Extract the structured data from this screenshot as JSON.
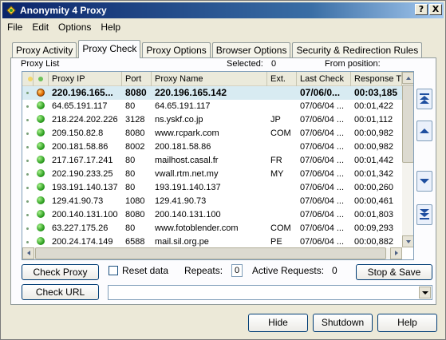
{
  "window": {
    "title": "Anonymity 4 Proxy",
    "help_btn": "?",
    "close_btn": "X"
  },
  "menu": [
    "File",
    "Edit",
    "Options",
    "Help"
  ],
  "tabs": [
    {
      "label": "Proxy Activity"
    },
    {
      "label": "Proxy Check",
      "active": true
    },
    {
      "label": "Proxy Options"
    },
    {
      "label": "Browser Options"
    },
    {
      "label": "Security & Redirection Rules"
    }
  ],
  "panel": {
    "list_label": "Proxy List",
    "selected_label": "Selected:",
    "selected_value": "0",
    "from_position_label": "From position:"
  },
  "table": {
    "columns": [
      "",
      "",
      "Proxy IP",
      "Port",
      "Proxy Name",
      "Ext.",
      "Last Check",
      "Response Time"
    ],
    "rows": [
      {
        "ip": "220.196.165...",
        "port": "8080",
        "name": "220.196.165.142",
        "ext": "",
        "last_check": "07/06/0...",
        "response": "00:03,185",
        "status": "busy",
        "selected": true
      },
      {
        "ip": "64.65.191.117",
        "port": "80",
        "name": "64.65.191.117",
        "ext": "",
        "last_check": "07/06/04 ...",
        "response": "00:01,422",
        "status": "ok"
      },
      {
        "ip": "218.224.202.226",
        "port": "3128",
        "name": "ns.yskf.co.jp",
        "ext": "JP",
        "last_check": "07/06/04 ...",
        "response": "00:01,112",
        "status": "ok"
      },
      {
        "ip": "209.150.82.8",
        "port": "8080",
        "name": "www.rcpark.com",
        "ext": "COM",
        "last_check": "07/06/04 ...",
        "response": "00:00,982",
        "status": "ok"
      },
      {
        "ip": "200.181.58.86",
        "port": "8002",
        "name": "200.181.58.86",
        "ext": "",
        "last_check": "07/06/04 ...",
        "response": "00:00,982",
        "status": "ok"
      },
      {
        "ip": "217.167.17.241",
        "port": "80",
        "name": "mailhost.casal.fr",
        "ext": "FR",
        "last_check": "07/06/04 ...",
        "response": "00:01,442",
        "status": "ok"
      },
      {
        "ip": "202.190.233.25",
        "port": "80",
        "name": "vwall.rtm.net.my",
        "ext": "MY",
        "last_check": "07/06/04 ...",
        "response": "00:01,342",
        "status": "ok"
      },
      {
        "ip": "193.191.140.137",
        "port": "80",
        "name": "193.191.140.137",
        "ext": "",
        "last_check": "07/06/04 ...",
        "response": "00:00,260",
        "status": "ok"
      },
      {
        "ip": "129.41.90.73",
        "port": "1080",
        "name": "129.41.90.73",
        "ext": "",
        "last_check": "07/06/04 ...",
        "response": "00:00,461",
        "status": "ok"
      },
      {
        "ip": "200.140.131.100",
        "port": "8080",
        "name": "200.140.131.100",
        "ext": "",
        "last_check": "07/06/04 ...",
        "response": "00:01,803",
        "status": "ok"
      },
      {
        "ip": "63.227.175.26",
        "port": "80",
        "name": "www.fotoblender.com",
        "ext": "COM",
        "last_check": "07/06/04 ...",
        "response": "00:09,293",
        "status": "ok"
      },
      {
        "ip": "200.24.174.149",
        "port": "6588",
        "name": "mail.sil.org.pe",
        "ext": "PE",
        "last_check": "07/06/04 ...",
        "response": "00:00,882",
        "status": "ok"
      }
    ]
  },
  "controls": {
    "check_proxy": "Check Proxy",
    "reset_data": "Reset data",
    "repeats_label": "Repeats:",
    "repeats_value": "0",
    "active_requests_label": "Active Requests:",
    "active_requests_value": "0",
    "stop_save": "Stop & Save",
    "check_url": "Check URL",
    "url_value": ""
  },
  "footer": {
    "hide": "Hide",
    "shutdown": "Shutdown",
    "help": "Help"
  },
  "colors": {
    "title_start": "#0a246a",
    "title_end": "#a6caf0",
    "selected_row": "#d8ebf2",
    "status_ok": "#2fa022",
    "status_busy": "#e06a00"
  },
  "icons": {
    "app": "diamond-app-icon",
    "nav": [
      "move-top-icon",
      "move-up-icon",
      "move-down-icon",
      "move-bottom-icon"
    ]
  }
}
